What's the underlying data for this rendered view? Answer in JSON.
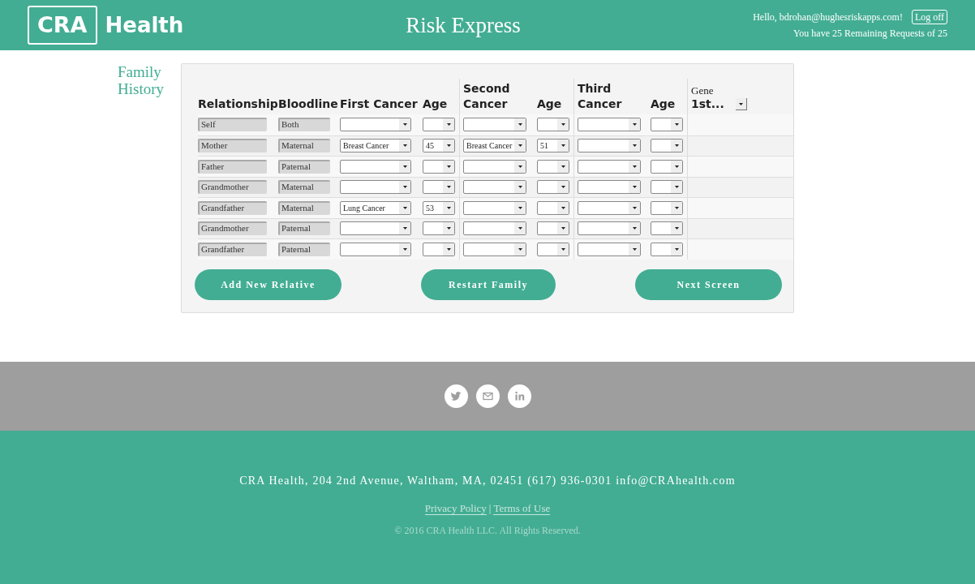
{
  "header": {
    "logo_badge": "CRA",
    "logo_text": "Health",
    "title": "Risk Express",
    "greeting": "Hello, bdrohan@hughesriskapps.com!",
    "logoff": "Log off",
    "requests": "You have 25 Remaining Requests of 25"
  },
  "section_title": "Family History",
  "table": {
    "columns": [
      "Relationship",
      "Bloodline",
      "First Cancer",
      "Age",
      "Second Cancer",
      "Age",
      "Third Cancer",
      "Age"
    ],
    "gene_label": "Gene",
    "gene_select": "1st...",
    "rows": [
      {
        "relationship": "Self",
        "bloodline": "Both"
      },
      {
        "relationship": "Mother",
        "bloodline": "Maternal",
        "first_cancer": "Breast Cancer",
        "first_age": "45",
        "second_cancer": "Breast Cancer",
        "second_age": "51"
      },
      {
        "relationship": "Father",
        "bloodline": "Paternal"
      },
      {
        "relationship": "Grandmother",
        "bloodline": "Maternal"
      },
      {
        "relationship": "Grandfather",
        "bloodline": "Maternal",
        "first_cancer": "Lung Cancer",
        "first_age": "53"
      },
      {
        "relationship": "Grandmother",
        "bloodline": "Paternal"
      },
      {
        "relationship": "Grandfather",
        "bloodline": "Paternal"
      }
    ]
  },
  "buttons": [
    "Add New Relative",
    "Restart Family",
    "Next Screen"
  ],
  "footer": {
    "address": "CRA Health, 204 2nd Avenue, Waltham, MA, 02451 (617) 936-0301 info@CRAhealth.com",
    "links": [
      "Privacy Policy",
      "Terms of Use"
    ],
    "separator": "|",
    "copyright": "© 2016 CRA Health LLC. All Rights Reserved."
  }
}
